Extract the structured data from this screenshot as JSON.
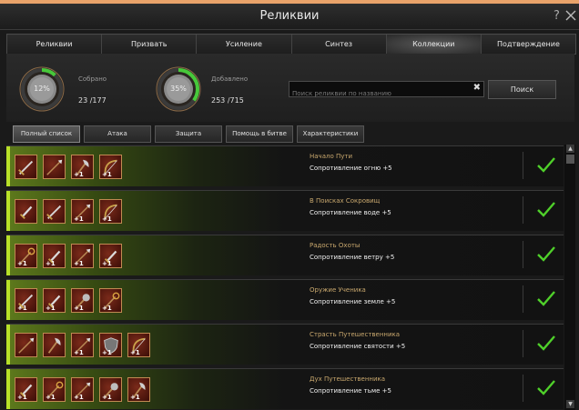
{
  "window": {
    "title": "Реликвии",
    "help": "?"
  },
  "tabs": [
    "Реликвии",
    "Призвать",
    "Усиление",
    "Синтез",
    "Коллекции",
    "Подтверждение"
  ],
  "stats": {
    "collected": {
      "label": "Собрано",
      "percent": "12%",
      "count": "23 /177",
      "progress": 0.12
    },
    "added": {
      "label": "Добавлено",
      "percent": "35%",
      "count": "253 /715",
      "progress": 0.35
    }
  },
  "search": {
    "placeholder": "Поиск реликвии по названию",
    "clear": "✖",
    "button": "Поиск"
  },
  "filters": [
    "Полный список",
    "Атака",
    "Защита",
    "Помощь в битве",
    "Характеристики"
  ],
  "colors": {
    "accent": "#b8e028",
    "check": "#4fd02a",
    "slot_border": "#c18a52"
  },
  "collections": [
    {
      "name": "Начало Пути",
      "bonus": "Сопротивление огню +5",
      "items": [
        {
          "icon": "sword-icon",
          "badge": ""
        },
        {
          "icon": "spear-icon",
          "badge": ""
        },
        {
          "icon": "axe-icon",
          "badge": "+1"
        },
        {
          "icon": "bow-icon",
          "badge": "+1"
        }
      ]
    },
    {
      "name": "В Поисках Сокровищ",
      "bonus": "Сопротивление воде +5",
      "items": [
        {
          "icon": "dagger-icon",
          "badge": ""
        },
        {
          "icon": "sword-icon",
          "badge": ""
        },
        {
          "icon": "spear-icon",
          "badge": "+1"
        },
        {
          "icon": "bow-icon",
          "badge": "+1"
        }
      ]
    },
    {
      "name": "Радость Охоты",
      "bonus": "Сопротивление ветру +5",
      "items": [
        {
          "icon": "staff-icon",
          "badge": "+1"
        },
        {
          "icon": "dagger-icon",
          "badge": "+1"
        },
        {
          "icon": "spear-icon",
          "badge": "+1"
        },
        {
          "icon": "dagger-icon",
          "badge": "+1"
        }
      ]
    },
    {
      "name": "Оружие Ученика",
      "bonus": "Сопротивление земле +5",
      "items": [
        {
          "icon": "sword-icon",
          "badge": "+1"
        },
        {
          "icon": "dagger-icon",
          "badge": "+1"
        },
        {
          "icon": "mace-icon",
          "badge": "+1"
        },
        {
          "icon": "staff-icon",
          "badge": "+1"
        }
      ]
    },
    {
      "name": "Страсть Путешественника",
      "bonus": "Сопротивление святости +5",
      "items": [
        {
          "icon": "spear-icon",
          "badge": ""
        },
        {
          "icon": "axe-icon",
          "badge": ""
        },
        {
          "icon": "spear-icon",
          "badge": "+1"
        },
        {
          "icon": "shield-icon",
          "badge": "+1"
        },
        {
          "icon": "bow-icon",
          "badge": "+1"
        }
      ]
    },
    {
      "name": "Дух Путешественника",
      "bonus": "Сопротивление тьме +5",
      "items": [
        {
          "icon": "dagger-icon",
          "badge": "+1"
        },
        {
          "icon": "staff-icon",
          "badge": "+1"
        },
        {
          "icon": "spear-icon",
          "badge": "+1"
        },
        {
          "icon": "mace-icon",
          "badge": "+1"
        },
        {
          "icon": "axe-icon",
          "badge": "+1"
        }
      ]
    }
  ],
  "scrollbar": {
    "up": "▲",
    "down": "▼"
  }
}
